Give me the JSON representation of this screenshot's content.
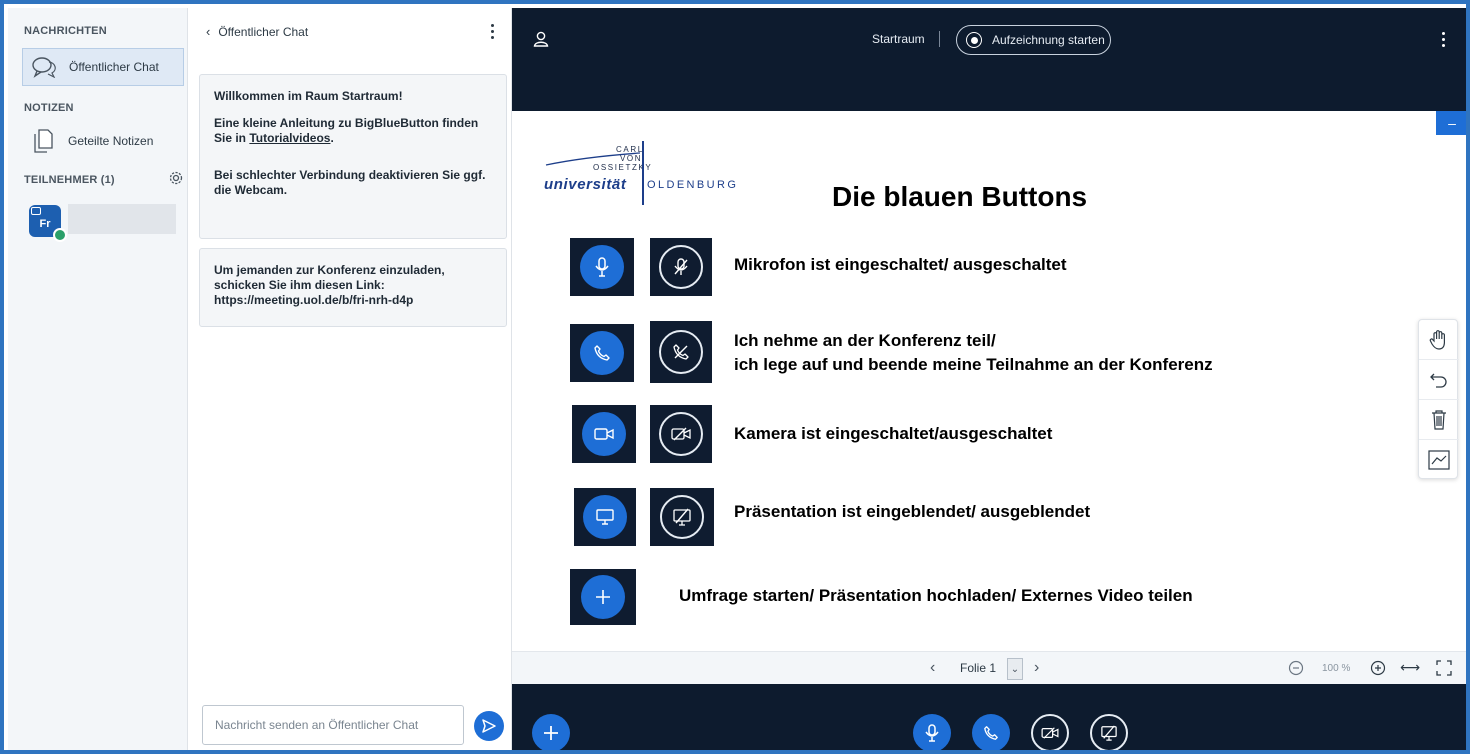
{
  "sidebar": {
    "messages_heading": "NACHRICHTEN",
    "public_chat_label": "Öffentlicher Chat",
    "notes_heading": "NOTIZEN",
    "shared_notes_label": "Geteilte Notizen",
    "participants_heading": "TEILNEHMER (1)",
    "avatar_initials": "Fr"
  },
  "chat": {
    "header_title": "Öffentlicher Chat",
    "welcome_line": "Willkommen im Raum Startraum!",
    "tutorial_prefix": "Eine kleine Anleitung zu BigBlueButton finden Sie in ",
    "tutorial_link": "Tutorialvideos",
    "tutorial_suffix": ".",
    "webcam_hint": "Bei schlechter Verbindung deaktivieren Sie ggf. die Webcam.",
    "invite_line": "Um jemanden zur Konferenz einzuladen, schicken Sie ihm diesen Link:",
    "invite_link": "https://meeting.uol.de/b/fri-nrh-d4p",
    "input_placeholder": "Nachricht senden an Öffentlicher Chat"
  },
  "topbar": {
    "room_name": "Startraum",
    "record_label": "Aufzeichnung starten"
  },
  "slide": {
    "logo_carl": "CARL",
    "logo_von": "VON",
    "logo_ossietzky": "OSSIETZKY",
    "logo_universitaet": "universität",
    "logo_oldenburg": "OLDENBURG",
    "title": "Die blauen Buttons",
    "rows": [
      {
        "text": "Mikrofon ist eingeschaltet/ ausgeschaltet"
      },
      {
        "text_line1": "Ich nehme an der Konferenz teil/",
        "text_line2": "ich lege auf und beende meine Teilnahme an der Konferenz"
      },
      {
        "text": "Kamera ist eingeschaltet/ausgeschaltet"
      },
      {
        "text": "Präsentation ist eingeblendet/  ausgeblendet"
      },
      {
        "text": "Umfrage starten/ Präsentation hochladen/ Externes Video teilen"
      }
    ]
  },
  "slide_toolbar": {
    "slide_label": "Folie 1",
    "zoom_label": "100 %"
  },
  "colors": {
    "accent_blue": "#1e6ed6",
    "dark_bg": "#0d1b2e",
    "frame_blue": "#2f74c0"
  }
}
